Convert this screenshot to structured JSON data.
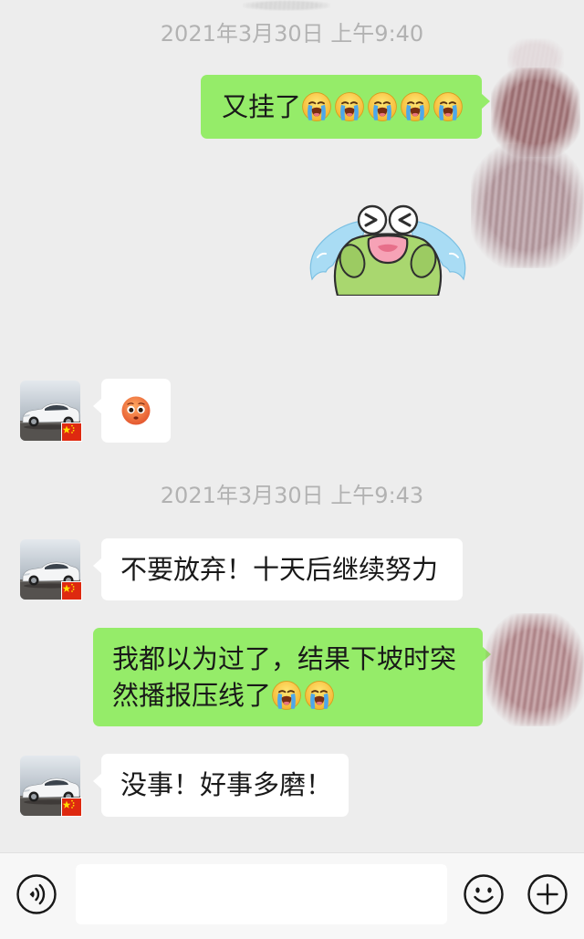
{
  "chat": [
    {
      "timestamp": "2021年3月30日 上午9:40"
    },
    {
      "sent": {
        "text": "又挂了",
        "emoji": [
          "loudly-crying-face",
          "loudly-crying-face",
          "loudly-crying-face",
          "loudly-crying-face",
          "loudly-crying-face"
        ]
      }
    },
    {
      "sent": {
        "sticker": "crying-frog-sticker"
      }
    },
    {
      "received": {
        "emoji": [
          "flushed-face"
        ]
      }
    },
    {
      "timestamp": "2021年3月30日 上午9:43"
    },
    {
      "received": {
        "text": "不要放弃！十天后继续努力"
      }
    },
    {
      "sent": {
        "text": "我都以为过了，结果下坡时突然播报压线了",
        "emoji": [
          "loudly-crying-face",
          "loudly-crying-face"
        ]
      }
    },
    {
      "received": {
        "text": "没事！好事多磨！"
      }
    }
  ],
  "contact_avatar": {
    "icon": "sports-car-avatar",
    "badge_icon": "china-flag-badge"
  },
  "self_avatar": {
    "icon": "redacted-scribble"
  },
  "input_bar": {
    "voice_icon": "voice-icon",
    "input_value": "",
    "emoji_icon": "smile-icon",
    "more_icon": "plus-circle-icon"
  },
  "colors": {
    "background": "#ededed",
    "sent_bubble": "#95ec69",
    "received_bubble": "#ffffff",
    "timestamp_text": "#b2b2b2",
    "message_text": "#191919",
    "input_bar": "#f7f7f7"
  }
}
